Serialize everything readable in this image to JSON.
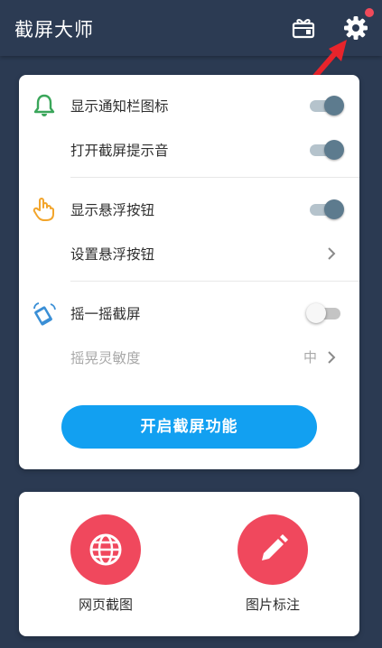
{
  "app_bar": {
    "title": "截屏大师",
    "gift_icon": "gift-box-icon",
    "settings_icon": "gear-icon",
    "has_notification_dot": true
  },
  "settings": {
    "show_notification_icon": {
      "label": "显示通知栏图标",
      "icon": "bell-icon",
      "enabled": true
    },
    "screenshot_sound": {
      "label": "打开截屏提示音",
      "enabled": true
    },
    "show_floating_button": {
      "label": "显示悬浮按钮",
      "icon": "hand-pointer-icon",
      "enabled": true
    },
    "floating_button_settings": {
      "label": "设置悬浮按钮"
    },
    "shake_to_screenshot": {
      "label": "摇一摇截屏",
      "icon": "shake-phone-icon",
      "enabled": false
    },
    "shake_sensitivity": {
      "label": "摇晃灵敏度",
      "value": "中"
    }
  },
  "start_button": {
    "label": "开启截屏功能"
  },
  "tools": {
    "web_screenshot": {
      "label": "网页截图",
      "icon": "globe-icon"
    },
    "image_annotation": {
      "label": "图片标注",
      "icon": "pencil-icon"
    }
  },
  "colors": {
    "background": "#2b3a52",
    "accent_blue": "#12a0f1",
    "tool_red": "#f0485d",
    "bell_green": "#3aa65a",
    "hand_orange": "#f2a52c",
    "shake_blue": "#3a8fd6"
  }
}
